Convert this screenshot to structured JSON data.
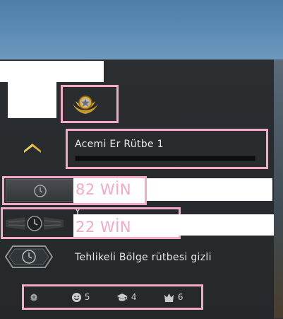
{
  "rank": {
    "title": "Acemi Er Rütbe 1",
    "progress": 0.0
  },
  "wins_primary": {
    "label": "82 WİN"
  },
  "wins_secondary": {
    "label": "22 WİN",
    "obscured_text": "Y"
  },
  "danger_zone": {
    "label": "Tehlikeli Bölge rütbesi gizli"
  },
  "stats": {
    "friendly": {
      "value": "5",
      "icon": "smiley-icon"
    },
    "teacher": {
      "value": "4",
      "icon": "graduation-cap-icon"
    },
    "leader": {
      "value": "6",
      "icon": "crown-icon"
    }
  },
  "colors": {
    "highlight": "#f4a9c9",
    "accent_gold": "#e2b43a",
    "panel": "#2a2e31"
  }
}
